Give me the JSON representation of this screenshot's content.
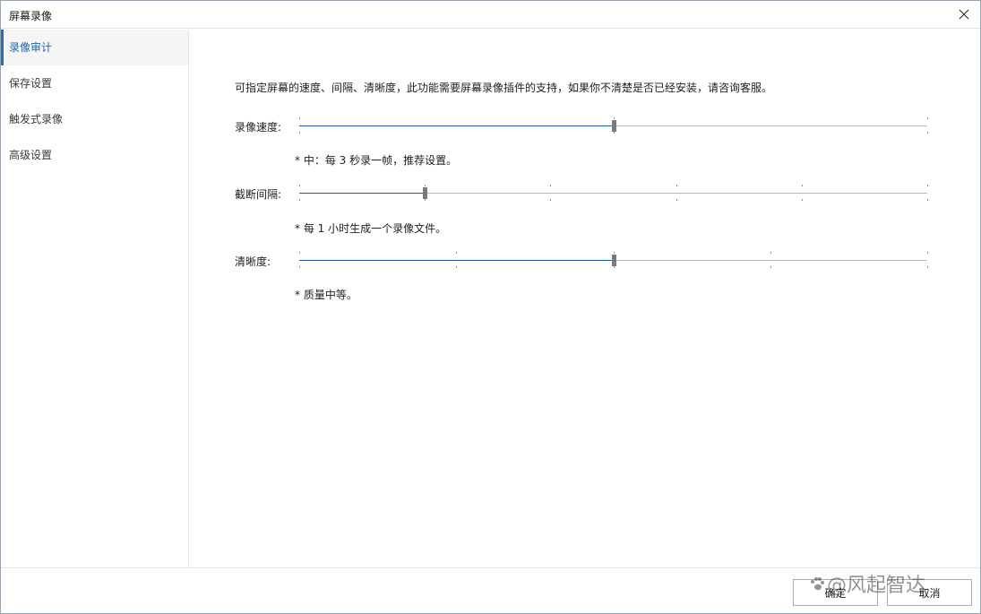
{
  "window": {
    "title": "屏幕录像"
  },
  "sidebar": {
    "items": [
      {
        "label": "录像审计",
        "active": true
      },
      {
        "label": "保存设置",
        "active": false
      },
      {
        "label": "触发式录像",
        "active": false
      },
      {
        "label": "高级设置",
        "active": false
      }
    ]
  },
  "main": {
    "description": "可指定屏幕的速度、间隔、清晰度，此功能需要屏幕录像插件的支持，如果你不清楚是否已经安装，请咨询客服。",
    "speed": {
      "label": "录像速度:",
      "hint": "* 中：每 3 秒录一帧，推荐设置。",
      "ticks": 3,
      "value_index": 1
    },
    "interval": {
      "label": "截断间隔:",
      "hint": "* 每 1 小时生成一个录像文件。",
      "ticks": 6,
      "value_index": 1
    },
    "clarity": {
      "label": "清晰度:",
      "hint": "* 质量中等。",
      "ticks": 5,
      "value_index": 2
    }
  },
  "footer": {
    "ok_label": "确定",
    "cancel_label": "取消"
  },
  "watermark": {
    "text": "@风起智达"
  },
  "colors": {
    "accent": "#1e6fc0",
    "track_filled": "#1f5fa5",
    "track_empty": "#b9b9b9",
    "thumb": "#7a7a7a"
  }
}
